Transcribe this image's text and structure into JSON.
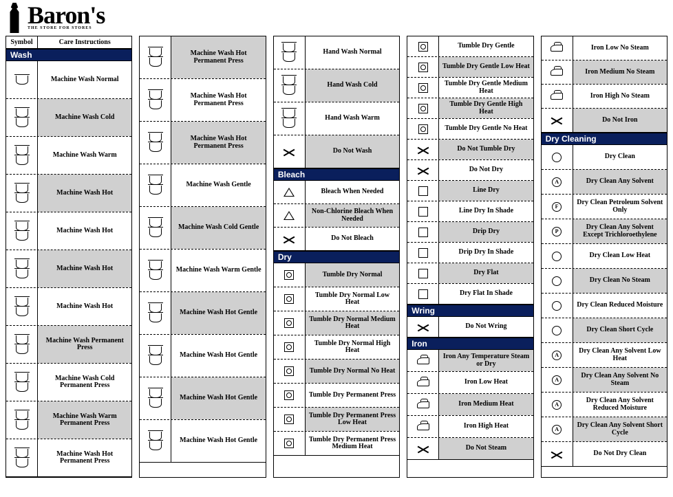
{
  "logo": {
    "brand": "Baron's",
    "tag": "THE STORE FOR STORES"
  },
  "header": {
    "symbol": "Symbol",
    "instructions": "Care Instructions"
  },
  "sections": {
    "wash": "Wash",
    "bleach": "Bleach",
    "dry": "Dry",
    "wring": "Wring",
    "iron": "Iron",
    "dryclean": "Dry Cleaning"
  },
  "col1": [
    "Machine Wash Normal",
    "Machine Wash Cold",
    "Machine Wash Warm",
    "Machine Wash Hot",
    "Machine Wash Hot",
    "Machine Wash Hot",
    "Machine Wash Hot",
    "Machine Wash Permanent Press",
    "Machine Wash Cold Permanent Press",
    "Machine Wash Warm Permanent Press",
    "Machine Wash Hot Permanent Press"
  ],
  "col2": [
    "Machine Wash Hot Permanent Press",
    "Machine Wash Hot Permanent Press",
    "Machine Wash Hot Permanent Press",
    "Machine Wash Gentle",
    "Machine Wash Cold Gentle",
    "Machine Wash Warm Gentle",
    "Machine Wash Hot Gentle",
    "Machine Wash Hot Gentle",
    "Machine Wash Hot Gentle",
    "Machine Wash Hot Gentle"
  ],
  "col3a": [
    "Hand Wash Normal",
    "Hand Wash Cold",
    "Hand Wash Warm",
    "Do Not Wash"
  ],
  "col3b": [
    "Bleach When Needed",
    "Non-Chlorine Bleach When Needed",
    "Do Not Bleach"
  ],
  "col3c": [
    "Tumble Dry Normal",
    "Tumble Dry Normal Low Heat",
    "Tumble Dry Normal Medium Heat",
    "Tumble Dry Normal High Heat",
    "Tumble Dry Normal No Heat",
    "Tumble Dry Permanent Press",
    "Tumble Dry Permanent Press Low Heat",
    "Tumble Dry Permanent Press Medium Heat"
  ],
  "col4a": [
    "Tumble Dry Gentle",
    "Tumble Dry Gentle Low Heat",
    "Tumble Dry Gentle Medium Heat",
    "Tumble Dry Gentle High Heat",
    "Tumble Dry Gentle No Heat",
    "Do Not Tumble Dry",
    "Do Not Dry",
    "Line Dry",
    "Line Dry In Shade",
    "Drip Dry",
    "Drip Dry In Shade",
    "Dry Flat",
    "Dry Flat In Shade"
  ],
  "col4b": [
    "Do Not Wring"
  ],
  "col4c": [
    "Iron Any Temperature Steam or Dry",
    "Iron Low Heat",
    "Iron Medium Heat",
    "Iron High Heat",
    "Do Not Steam"
  ],
  "col5a": [
    "Iron Low No Steam",
    "Iron Medium No Steam",
    "Iron High No Steam",
    "Do Not Iron"
  ],
  "col5b": [
    "Dry Clean",
    "Dry Clean Any Solvent",
    "Dry Clean Petroleum Solvent Only",
    "Dry Clean Any Solvent Except Trichloroethylene",
    "Dry Clean Low Heat",
    "Dry Clean No Steam",
    "Dry Clean Reduced Moisture",
    "Dry Clean Short Cycle",
    "Dry Clean Any Solvent Low Heat",
    "Dry Clean Any Solvent No Steam",
    "Dry Clean Any Solvent Reduced Moisture",
    "Dry Clean Any Solvent Short Cycle",
    "Do Not Dry Clean"
  ]
}
